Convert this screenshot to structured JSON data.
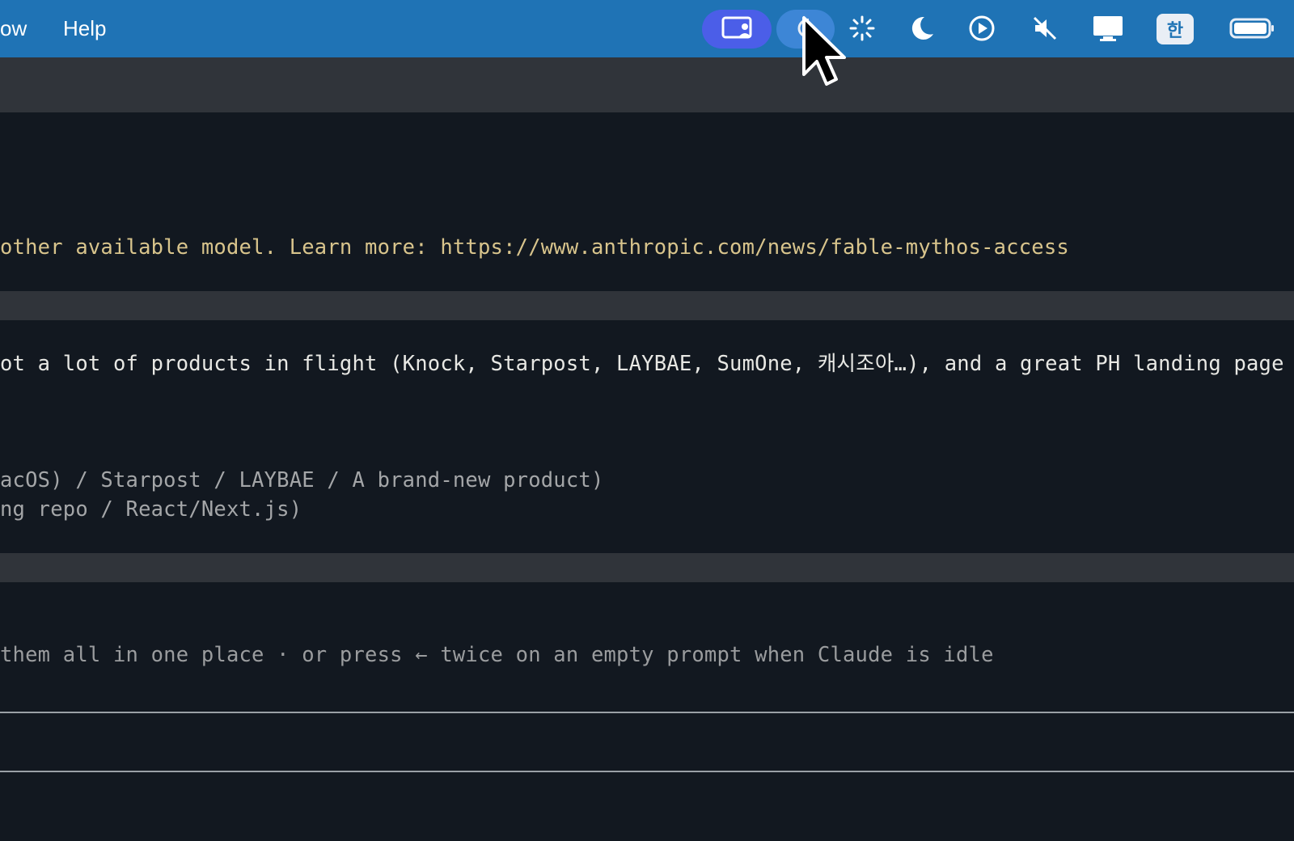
{
  "menubar": {
    "items": [
      "ow",
      "Help"
    ],
    "status_icons": [
      "screen-share-icon",
      "focus-mode-icon",
      "brightness-icon",
      "moon-icon",
      "play-circle-icon",
      "muted-speaker-icon",
      "display-icon",
      "input-source-icon",
      "battery-icon"
    ],
    "input_source": "한"
  },
  "terminal": {
    "notice": "other available model. Learn more: https://www.anthropic.com/news/fable-mythos-access",
    "message": "ot a lot of products in flight (Knock, Starpost, LAYBAE, SumOne, 캐시조아…), and a great PH landing page depe",
    "option_line_1": "acOS) / Starpost / LAYBAE / A brand-new product)",
    "option_line_2": "ng repo / React/Next.js)",
    "hint": "them all in one place · or press ← twice on an empty prompt when Claude is idle"
  },
  "colors": {
    "menubar_bg": "#1f73b5",
    "terminal_bg": "#121820",
    "band": "#30343a",
    "highlight_text": "#d8c48c",
    "active_pill": "#4b5ee8"
  }
}
